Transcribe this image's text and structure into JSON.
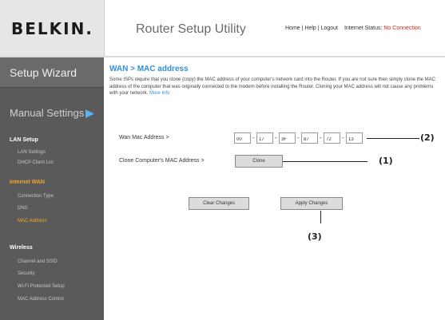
{
  "header": {
    "logo": "BELKIN.",
    "app_title": "Router Setup Utility",
    "links": [
      "Home",
      "Help",
      "Logout"
    ],
    "status_label": "Internet Status:",
    "status_value": "No Connection"
  },
  "sidebar": {
    "setup_wizard": "Setup Wizard",
    "manual_settings": "Manual Settings",
    "manual_arrow": "▶",
    "sections": [
      {
        "label": "LAN Setup",
        "items": [
          "LAN Settings",
          "DHCP Client List"
        ]
      },
      {
        "label": "Internet WAN",
        "items": [
          "Connection Type",
          "DNS",
          "MAC Address"
        ]
      },
      {
        "label": "Wireless",
        "items": [
          "Channel and SSID",
          "Security",
          "Wi-Fi Protected Setup",
          "MAC Address Control"
        ]
      }
    ]
  },
  "main": {
    "title": "WAN > MAC address",
    "description": "Some ISPs require that you clone (copy) the MAC address of your computer's network card into the Router. If you are not sure then simply clone the MAC address of the computer that was originally connected to the modem before installing the Router. Cloning your MAC address will not cause any problems with your network.",
    "more_info": "More Info",
    "wan_mac_label": "Wan Mac Address >",
    "mac_octets": [
      "00",
      "17",
      "3F",
      "87",
      "72",
      "13"
    ],
    "clone_label": "Clone Computer's MAC Address >",
    "clone_button": "Clone",
    "clear_button": "Clear Changes",
    "apply_button": "Apply Changes"
  },
  "callouts": {
    "mac_fields": "(2)",
    "clone": "(1)",
    "apply": "(3)"
  }
}
